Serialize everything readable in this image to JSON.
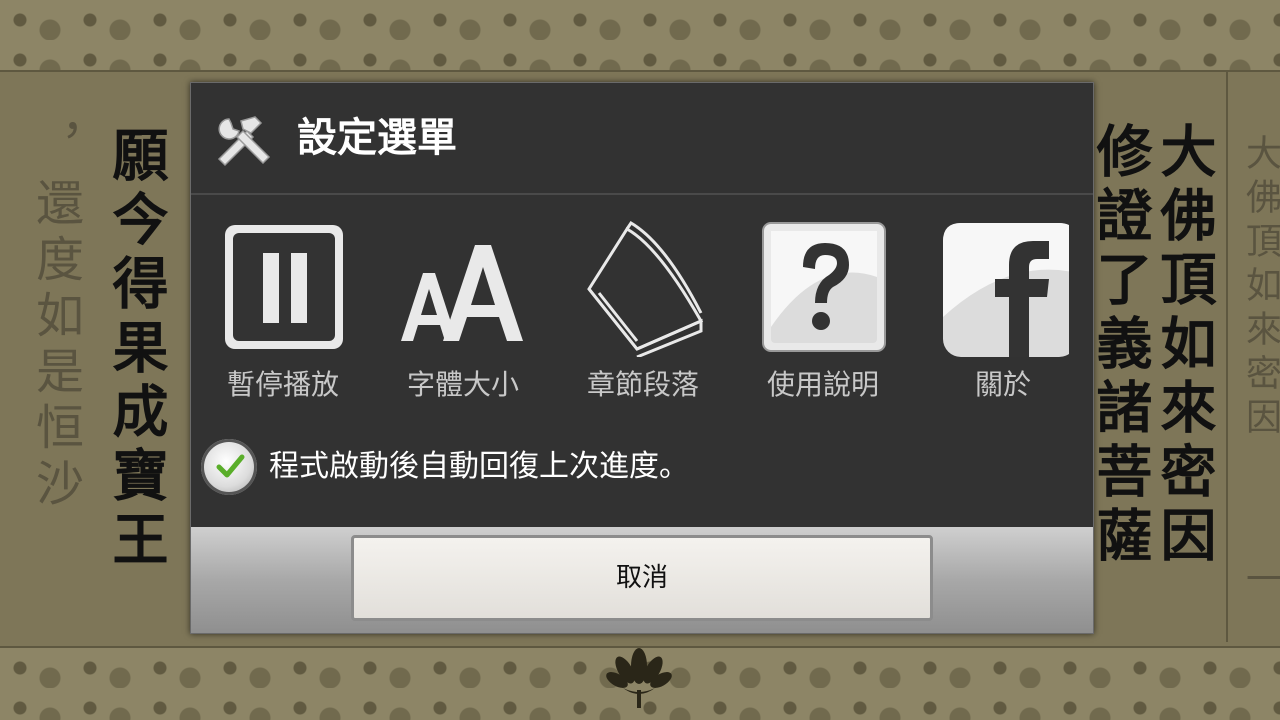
{
  "background": {
    "text_columns": [
      {
        "text": "大佛頂如來密因",
        "style": "dark"
      },
      {
        "text": "修證了義諸菩薩",
        "style": "dark"
      },
      {
        "text": "願今得果成寶王",
        "style": "dark"
      },
      {
        "text": "，還度如是恒沙",
        "style": "faint"
      },
      {
        "text": "大佛頂如來密因",
        "style": "small"
      },
      {
        "text": "一",
        "style": "small"
      }
    ]
  },
  "dialog": {
    "title": "設定選單",
    "title_icon": "tools-icon",
    "menu_items": [
      {
        "label": "暫停播放",
        "icon": "pause-icon"
      },
      {
        "label": "字體大小",
        "icon": "font-size-icon"
      },
      {
        "label": "章節段落",
        "icon": "book-icon"
      },
      {
        "label": "使用說明",
        "icon": "help-icon"
      },
      {
        "label": "關於",
        "icon": "facebook-icon"
      }
    ],
    "resume_option": {
      "label": "程式啟動後自動回復上次進度。",
      "checked": true
    },
    "cancel_label": "取消"
  },
  "colors": {
    "dialog_bg": "#323232",
    "page_bg": "#7e7658",
    "check_green": "#5aae2a"
  }
}
